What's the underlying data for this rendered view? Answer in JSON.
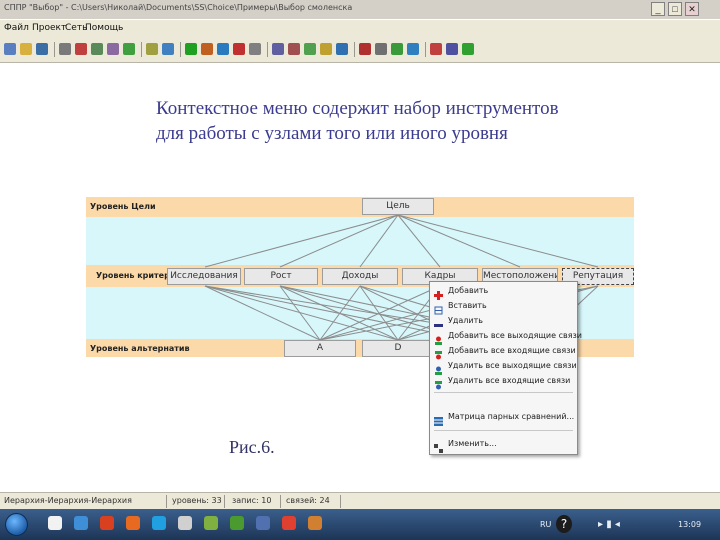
{
  "window": {
    "title": "СППР \"Выбор\" - C:\\Users\\Николай\\Documents\\SS\\Сhoice\\Примеры\\Выбор смоленска",
    "buttons": [
      "_",
      "□",
      "✕"
    ]
  },
  "menubar": {
    "items": [
      "Файл",
      "Проект",
      "Сеть",
      "Помощь"
    ]
  },
  "toolbar": {
    "icons": [
      "new-icon",
      "open-icon",
      "save-icon",
      "print-icon",
      "cut-icon",
      "copy-icon",
      "paste-icon",
      "undo-icon",
      "redo-icon",
      "node-icon",
      "play-icon",
      "step-icon",
      "globe-icon",
      "chart-icon",
      "zoom-icon",
      "find-icon",
      "grid-icon",
      "tree-icon",
      "link-icon",
      "levels-icon",
      "flag-icon",
      "properties-icon",
      "check-icon",
      "add-node-icon",
      "move-icon",
      "info-icon",
      "sort-icon"
    ],
    "colors": [
      "#5a7fc0",
      "#d8b040",
      "#3a6ea5",
      "#7a7a7a",
      "#c04040",
      "#5a8a5a",
      "#8a6aa0",
      "#40a040",
      "#a0a040",
      "#4080c0",
      "#20a020",
      "#c06020",
      "#2a7ac0",
      "#c03030",
      "#808080",
      "#6060a0",
      "#a05050",
      "#50a050",
      "#c0a030",
      "#3070b0",
      "#b03030",
      "#707070",
      "#3a9a3a",
      "#3080c0",
      "#c04040",
      "#5050a0",
      "#30a030"
    ]
  },
  "heading": {
    "line1": "Контекстное меню содержит набор инструментов",
    "line2": "для работы с узлами того или иного уровня"
  },
  "hierarchy": {
    "band_colors": {
      "goal": "#fbd9a9",
      "between": "#d7f7fb",
      "criteria": "#fbd9a9",
      "alternatives": "#fbd9a9"
    },
    "levels": {
      "goal": "Уровень Цели",
      "criteria": "Уровень критериев",
      "alternatives": "Уровень альтернатив"
    },
    "goal_node": "Цель",
    "criteria_nodes": [
      "Исследования",
      "Рост",
      "Доходы",
      "Кадры",
      "Местоположение",
      "Репутация"
    ],
    "alternative_nodes": [
      "A",
      "D"
    ]
  },
  "context_menu": {
    "items": [
      {
        "label": "Добавить",
        "icon": "add-icon",
        "color": "#d42020"
      },
      {
        "label": "Вставить",
        "icon": "paste-icon",
        "color": "#3060b0"
      },
      {
        "label": "Удалить",
        "icon": "delete-icon",
        "color": "#303080"
      },
      {
        "label": "Добавить все выходящие связи",
        "icon": "add-out-links-icon",
        "color": "#20a040"
      },
      {
        "label": "Добавить все входящие связи",
        "icon": "add-in-links-icon",
        "color": "#20a040"
      },
      {
        "label": "Удалить все выходящие связи",
        "icon": "remove-out-links-icon",
        "color": "#20a040"
      },
      {
        "label": "Удалить все входящие связи",
        "icon": "remove-in-links-icon",
        "color": "#20a040"
      },
      {
        "label": "Матрица парных сравнений...",
        "icon": "matrix-icon",
        "color": "#2a6ab0"
      },
      {
        "label": "Изменить...",
        "icon": "edit-icon",
        "color": "#404040"
      }
    ]
  },
  "caption": "Рис.6.",
  "statusbar": {
    "cells": [
      "Иерархия-Иерархия-Иерархия",
      "уровень: 33",
      "запис: 10",
      "связей: 24"
    ]
  },
  "taskbar": {
    "language": "RU",
    "clock": "13:09",
    "app_colors": [
      "#f2f2f2",
      "#3f8fd8",
      "#d84020",
      "#e86a20",
      "#20a0e0",
      "#d0d0d0",
      "#80b040",
      "#4a9a30",
      "#5070b0",
      "#e04030",
      "#d08030"
    ]
  }
}
